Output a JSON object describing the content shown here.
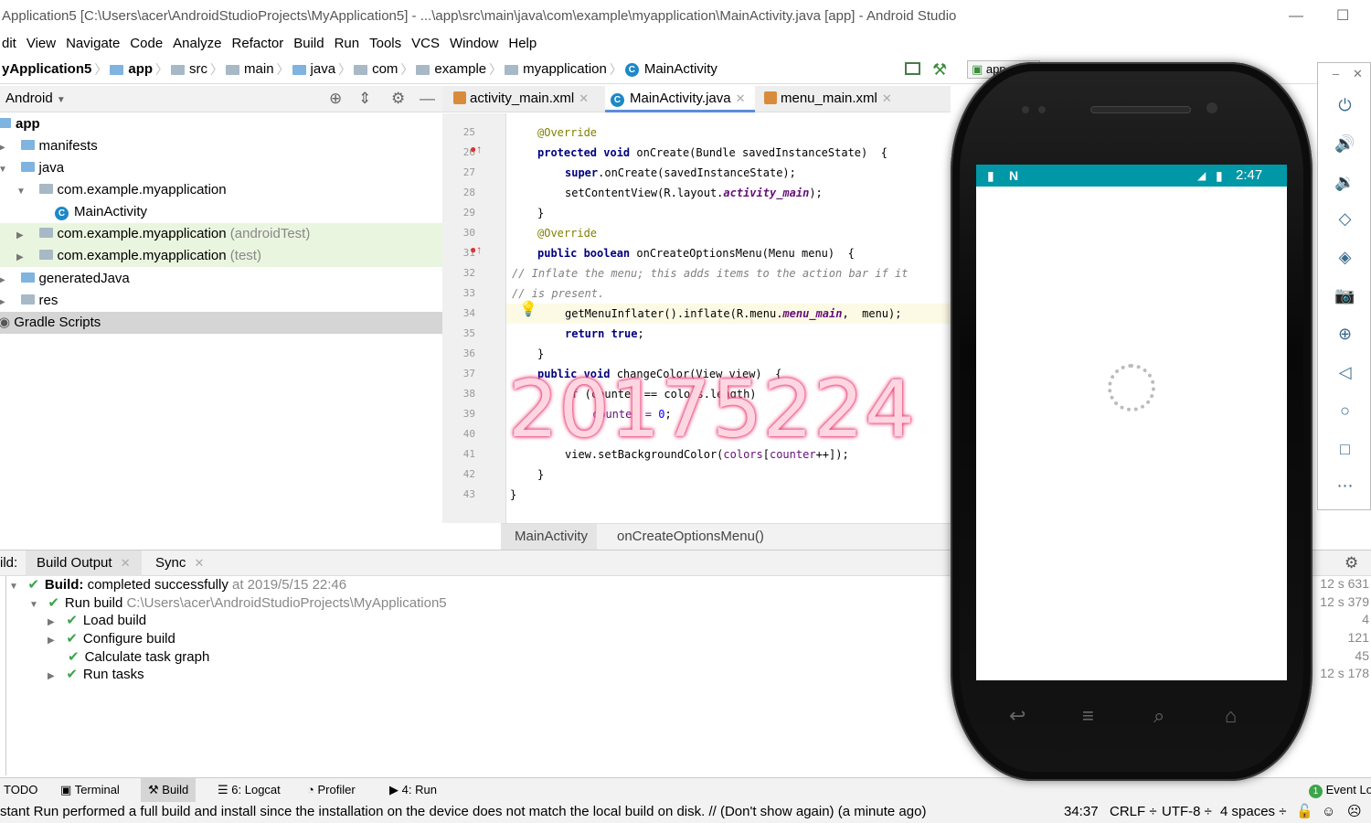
{
  "title": "Application5 [C:\\Users\\acer\\AndroidStudioProjects\\MyApplication5] - ...\\app\\src\\main\\java\\com\\example\\myapplication\\MainActivity.java [app] - Android Studio",
  "window_controls": {
    "minimize": "—",
    "maximize": "☐"
  },
  "menu": [
    "dit",
    "View",
    "Navigate",
    "Code",
    "Analyze",
    "Refactor",
    "Build",
    "Run",
    "Tools",
    "VCS",
    "Window",
    "Help"
  ],
  "breadcrumbs": [
    "yApplication5",
    "app",
    "src",
    "main",
    "java",
    "com",
    "example",
    "myapplication",
    "MainActivity"
  ],
  "project_panel": {
    "view_mode": "Android"
  },
  "tree": [
    {
      "label": "app",
      "note": ""
    },
    {
      "label": "manifests",
      "note": ""
    },
    {
      "label": "java",
      "note": ""
    },
    {
      "label": "com.example.myapplication",
      "note": ""
    },
    {
      "label": "MainActivity",
      "note": ""
    },
    {
      "label": "com.example.myapplication",
      "note": "(androidTest)"
    },
    {
      "label": "com.example.myapplication",
      "note": "(test)"
    },
    {
      "label": "generatedJava",
      "note": ""
    },
    {
      "label": "res",
      "note": ""
    },
    {
      "label": "Gradle Scripts",
      "note": ""
    }
  ],
  "editor_tabs": [
    "activity_main.xml",
    "MainActivity.java",
    "menu_main.xml"
  ],
  "line_numbers": [
    "25",
    "26",
    "27",
    "28",
    "29",
    "30",
    "31",
    "32",
    "33",
    "34",
    "35",
    "36",
    "37",
    "38",
    "39",
    "40",
    "41",
    "42",
    "43"
  ],
  "code": {
    "l25": "@Override",
    "l26a": "protected void",
    "l26b": " onCreate(Bundle savedInstanceState)  {",
    "l27a": "super",
    "l27b": ".onCreate(savedInstanceState);",
    "l28a": "setContentView(R.layout.",
    "l28b": "activity_main",
    "l28c": ");",
    "l29": "}",
    "l30": "@Override",
    "l31a": "public boolean",
    "l31b": " onCreateOptionsMenu(Menu menu)  {",
    "l32": "// Inflate the menu; this adds items to the action bar if it",
    "l33": "// is present.",
    "l34a": "getMenuInflater().inflate(R.menu.",
    "l34b": "menu_main",
    "l34c": ",  menu);",
    "l35a": "return true",
    "l35b": ";",
    "l36": "}",
    "l37a": "public void",
    "l37b": " changeColor(View view)  {",
    "l38": "if (counter == colors.length)",
    "l39a": "counter = ",
    "l39b": "0",
    "l39c": ";",
    "l41a": "view.setBackgroundColor(",
    "l41b": "colors",
    "l41c": "[",
    "l41d": "counter",
    "l41e": "++]);",
    "l42": "}",
    "l43": "}"
  },
  "editor_crumbs": [
    "MainActivity",
    "onCreateOptionsMenu()"
  ],
  "build_panel": {
    "label": "ild:",
    "tabs": [
      "Build Output",
      "Sync"
    ],
    "rows": [
      {
        "bold": "Build:",
        "text": " completed successfully",
        "extra": " at 2019/5/15 22:46",
        "time": "12 s 631"
      },
      {
        "bold": "",
        "text": "Run build ",
        "extra": "C:\\Users\\acer\\AndroidStudioProjects\\MyApplication5",
        "time": "12 s 379"
      },
      {
        "bold": "",
        "text": "Load build",
        "extra": "",
        "time": "4"
      },
      {
        "bold": "",
        "text": "Configure build",
        "extra": "",
        "time": "121"
      },
      {
        "bold": "",
        "text": "Calculate task graph",
        "extra": "",
        "time": "45"
      },
      {
        "bold": "",
        "text": "Run tasks",
        "extra": "",
        "time": "12 s 178"
      }
    ]
  },
  "tool_windows": [
    "TODO",
    "Terminal",
    "Build",
    "6: Logcat",
    "Profiler",
    "4: Run"
  ],
  "event_log": "Event Lo",
  "event_count": "1",
  "status": {
    "message": "stant Run performed a full build and install since the installation on the device does not match the local build on disk. // (Don't show again) (a minute ago)",
    "position": "34:37",
    "line_sep": "CRLF ÷",
    "encoding": "UTF-8 ÷",
    "indent": "4 spaces ÷"
  },
  "emulator": {
    "time": "2:47",
    "run_config_label": "app"
  },
  "watermark": "20175224",
  "colors": {
    "accent": "#5b8dd9",
    "status_bar": "#0097a7",
    "success": "#3ca44a",
    "selection": "#d5d5d5",
    "highlight": "#eaf5df"
  }
}
